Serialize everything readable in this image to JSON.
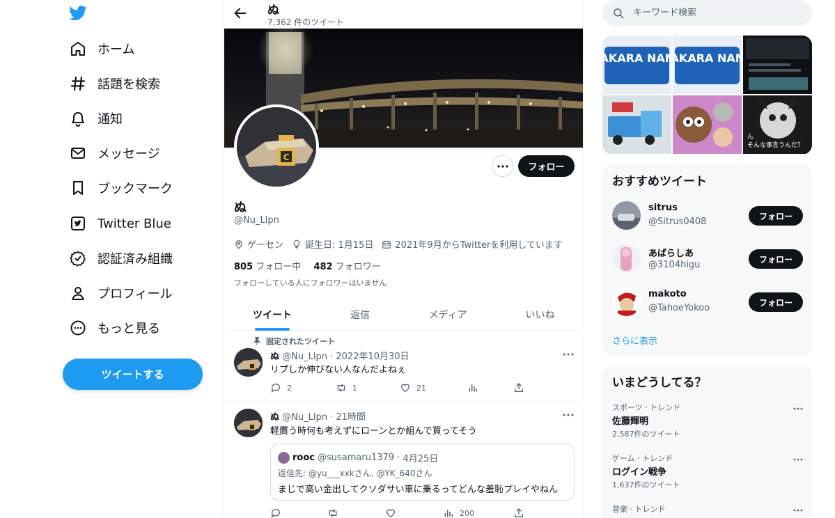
{
  "nav": {
    "items": [
      {
        "label": "ホーム",
        "icon": "home-icon"
      },
      {
        "label": "話題を検索",
        "icon": "hashtag-icon"
      },
      {
        "label": "通知",
        "icon": "bell-icon"
      },
      {
        "label": "メッセージ",
        "icon": "envelope-icon"
      },
      {
        "label": "ブックマーク",
        "icon": "bookmark-icon"
      },
      {
        "label": "Twitter Blue",
        "icon": "twitter-blue-icon"
      },
      {
        "label": "認証済み組織",
        "icon": "verified-org-icon"
      },
      {
        "label": "プロフィール",
        "icon": "person-icon"
      },
      {
        "label": "もっと見る",
        "icon": "more-circle-icon"
      }
    ],
    "tweet_button": "ツイートする"
  },
  "profile": {
    "name": "ぬ",
    "tweet_count": "7,362 件のツイート",
    "handle": "@Nu_Llpn",
    "follow_button": "フォロー",
    "location": "ゲーセン",
    "birthday": "誕生日: 1月15日",
    "joined": "2021年9月からTwitterを利用しています",
    "following_count": "805",
    "following_label": "フォロー中",
    "followers_count": "482",
    "followers_label": "フォロワー",
    "mutual_note": "フォローしている人にフォロワーはいません"
  },
  "tabs": [
    "ツイート",
    "返信",
    "メディア",
    "いいね"
  ],
  "tweets": [
    {
      "pinned_label": "固定されたツイート",
      "name": "ぬ",
      "handle": "@Nu_Llpn",
      "time": "2022年10月30日",
      "text": "リプしか伸びない人なんだよねぇ",
      "replies": "2",
      "retweets": "1",
      "likes": "21"
    },
    {
      "name": "ぬ",
      "handle": "@Nu_Llpn",
      "time": "21時間",
      "text": "軽贋う時何も考えずにローンとか組んで買ってそう",
      "quote": {
        "name": "rooc",
        "handle": "@susamaru1379",
        "time": "4月25日",
        "reply_to": "返信先: @yu___xxkさん, @YK_640さん",
        "text": "まじで高い金出してクソダサい車に乗るってどんな羞恥プレイやねん"
      },
      "views": "200"
    }
  ],
  "sidebar": {
    "search_placeholder": "キーワード検索",
    "media_grid": {
      "cell1_text": "DAKARA NANY",
      "cell2_text": "DAKARA NANY",
      "cell6_caption_line1": "ん",
      "cell6_caption_line2": "そんな事言うんだ？"
    },
    "recommend_title": "おすすめツイート",
    "recommend": [
      {
        "name": "sitrus",
        "handle": "@Sitrus0408",
        "button": "フォロー"
      },
      {
        "name": "あばらしあ",
        "handle": "@3104higu",
        "button": "フォロー"
      },
      {
        "name": "makoto",
        "handle": "@TahoeYokoo",
        "button": "フォロー"
      }
    ],
    "show_more": "さらに表示",
    "trends_title": "いまどうしてる？",
    "trends": [
      {
        "category": "スポーツ · トレンド",
        "name": "佐藤輝明",
        "count": "2,587件のツイート"
      },
      {
        "category": "ゲーム · トレンド",
        "name": "ログイン戦争",
        "count": "1,637件のツイート"
      },
      {
        "category": "音楽 · トレンド",
        "name": "",
        "count": ""
      }
    ]
  },
  "colors": {
    "accent": "#1d9bf0",
    "text": "#0f1419",
    "muted": "#536471",
    "border": "#eff3f4"
  }
}
